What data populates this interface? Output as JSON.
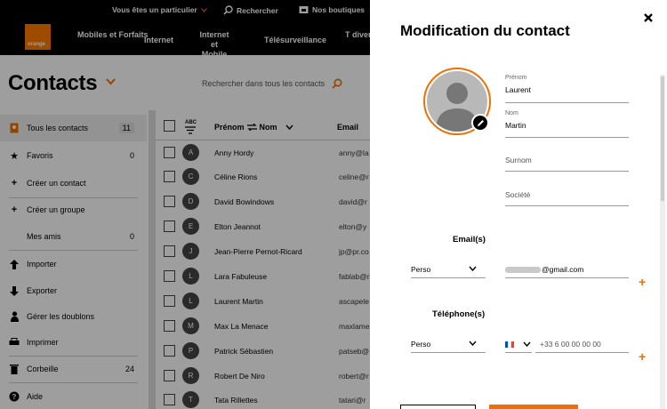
{
  "header": {
    "util_links": [
      "Vous êtes un particulier",
      "Rechercher",
      "Nos boutiques"
    ],
    "logo_text": "orange",
    "nav": [
      "Mobiles et Forfaits",
      "Internet",
      "Internet et Mobile",
      "Télésurveillance",
      "T divert"
    ]
  },
  "contacts": {
    "title": "Contacts",
    "search_placeholder": "Rechercher dans tous les contacts"
  },
  "sidebar": {
    "items": [
      {
        "label": "Tous les contacts",
        "count": "11",
        "icon": "address-book-icon"
      },
      {
        "label": "Favoris",
        "count": "0",
        "icon": "star-icon"
      },
      {
        "label": "Créer un contact",
        "count": "",
        "icon": "plus-icon"
      },
      {
        "label": "Créer un groupe",
        "count": "",
        "icon": "plus-icon"
      },
      {
        "label": "Mes amis",
        "count": "0",
        "icon": ""
      },
      {
        "label": "Importer",
        "count": "",
        "icon": "arrow-up-icon"
      },
      {
        "label": "Exporter",
        "count": "",
        "icon": "arrow-down-icon"
      },
      {
        "label": "Gérer les doublons",
        "count": "",
        "icon": "people-icon"
      },
      {
        "label": "Imprimer",
        "count": "",
        "icon": "printer-icon"
      },
      {
        "label": "Corbeille",
        "count": "24",
        "icon": "trash-icon"
      },
      {
        "label": "Aide",
        "count": "",
        "icon": "help-icon"
      }
    ]
  },
  "list": {
    "sort_label": "ABC",
    "col_first": "Prénom",
    "col_last": "Nom",
    "col_email": "Email",
    "rows": [
      {
        "initial": "A",
        "name": "Anny Hordy",
        "email": "anny@la"
      },
      {
        "initial": "C",
        "name": "Céline Rions",
        "email": "celine@r"
      },
      {
        "initial": "D",
        "name": "David Bowindows",
        "email": "david@r"
      },
      {
        "initial": "E",
        "name": "Elton Jeannot",
        "email": "elton@y"
      },
      {
        "initial": "J",
        "name": "Jean-Pierre Pernot-Ricard",
        "email": "jp@pr.co"
      },
      {
        "initial": "L",
        "name": "Lara Fabuleuse",
        "email": "fablab@r"
      },
      {
        "initial": "L",
        "name": "Laurent Martin",
        "email": "ascapele"
      },
      {
        "initial": "M",
        "name": "Max La Menace",
        "email": "maxlame"
      },
      {
        "initial": "P",
        "name": "Patrick Sébastien",
        "email": "patseb@"
      },
      {
        "initial": "R",
        "name": "Robert De Niro",
        "email": "robert@r"
      },
      {
        "initial": "T",
        "name": "Tata Rillettes",
        "email": "tatari@r"
      }
    ]
  },
  "panel": {
    "title": "Modification du contact",
    "fields": {
      "first_label": "Prénom",
      "first_value": "Laurent",
      "last_label": "Nom",
      "last_value": "Martin",
      "nickname_placeholder": "Surnom",
      "company_placeholder": "Société"
    },
    "email_section": "Email(s)",
    "email_type": "Perso",
    "email_value": "@gmail.com",
    "phone_section": "Téléphone(s)",
    "phone_type": "Perso",
    "phone_placeholder": "+33 6 00 00 00 00",
    "plus": "+"
  },
  "colors": {
    "accent": "#f16e00",
    "topbar": "#000000",
    "overlay": "rgba(0,0,0,0.38)"
  }
}
